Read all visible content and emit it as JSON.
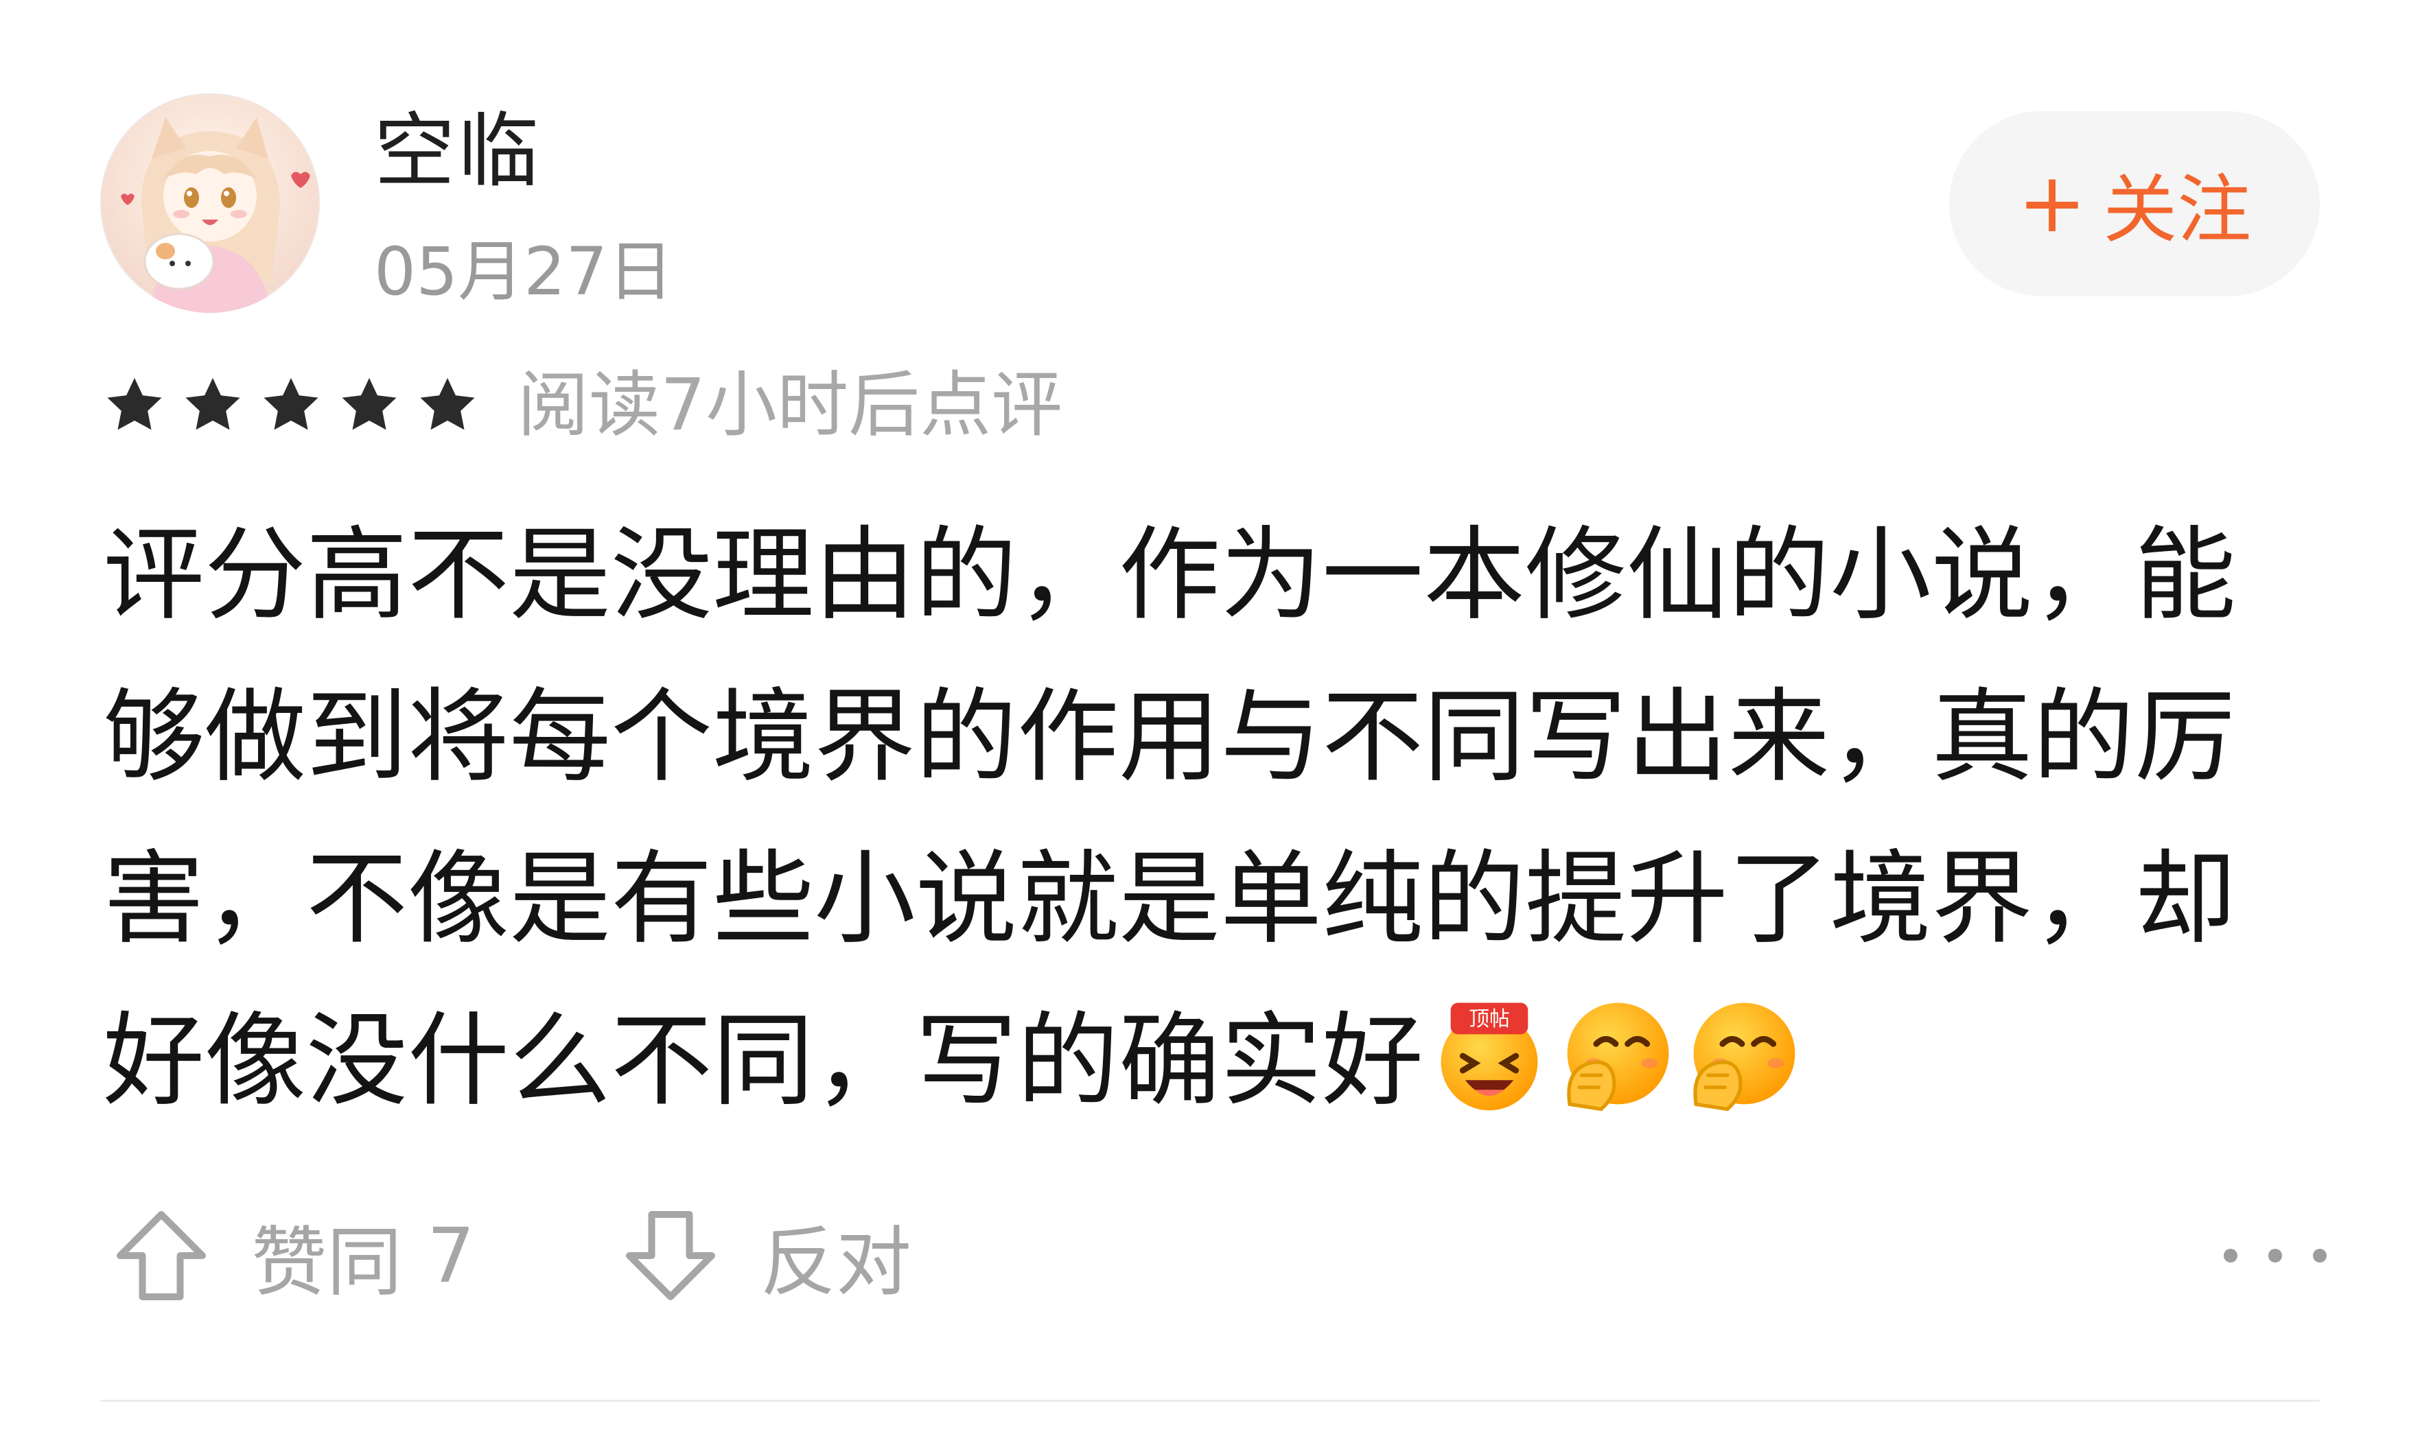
{
  "author": {
    "name": "空临",
    "date": "05月27日",
    "avatar_icon": "anime-girl-avatar"
  },
  "follow": {
    "plus_symbol": "+",
    "label": "关注",
    "color": "#f2662e"
  },
  "rating": {
    "stars": 5,
    "max_stars": 5,
    "star_color": "#2b2b2b",
    "read_meta": "阅读7小时后点评"
  },
  "comment": {
    "text": "评分高不是没理由的，作为一本修仙的小说，能够做到将每个境界的作用与不同写出来，真的厉害，不像是有些小说就是单纯的提升了境界，却好像没什么不同，写的确实好",
    "emojis": [
      {
        "name": "top-post-emoji",
        "badge": "顶帖"
      },
      {
        "name": "giggle-emoji"
      },
      {
        "name": "giggle-emoji"
      }
    ]
  },
  "actions": {
    "agree_label": "赞同",
    "agree_count": "7",
    "oppose_label": "反对",
    "agree_icon": "arrow-up-icon",
    "oppose_icon": "arrow-down-icon",
    "more_icon": "more-dots-icon"
  }
}
